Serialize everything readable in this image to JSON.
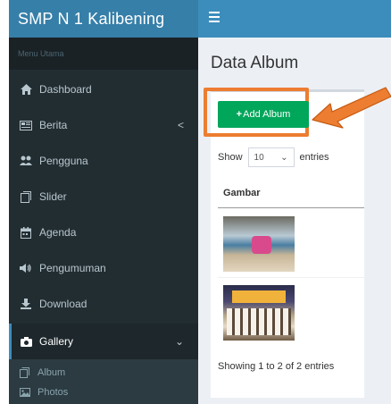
{
  "app": {
    "brand": "SMP N 1 Kalibening"
  },
  "sidebar": {
    "header": "Menu Utama",
    "items": [
      {
        "label": "Dashboard",
        "icon": "home-icon"
      },
      {
        "label": "Berita",
        "icon": "newspaper-icon",
        "chevron": "<"
      },
      {
        "label": "Pengguna",
        "icon": "users-icon"
      },
      {
        "label": "Slider",
        "icon": "slider-icon"
      },
      {
        "label": "Agenda",
        "icon": "calendar-icon"
      },
      {
        "label": "Pengumuman",
        "icon": "megaphone-icon"
      },
      {
        "label": "Download",
        "icon": "download-icon"
      },
      {
        "label": "Gallery",
        "icon": "camera-icon",
        "chevron": "⌄",
        "active": true
      }
    ],
    "submenu": [
      {
        "label": "Album",
        "icon": "album-icon"
      },
      {
        "label": "Photos",
        "icon": "image-icon"
      }
    ]
  },
  "main": {
    "title": "Data Album",
    "add_button": "Add Album",
    "show_label": "Show",
    "entries_value": "10",
    "entries_label": "entries",
    "column_header": "Gambar",
    "showing_text": "Showing 1 to 2 of 2 entries"
  },
  "colors": {
    "brand": "#367fa9",
    "topbar": "#3c8dbc",
    "sidebar": "#222d32",
    "add_button": "#00a65a",
    "highlight": "#ed7d31"
  }
}
